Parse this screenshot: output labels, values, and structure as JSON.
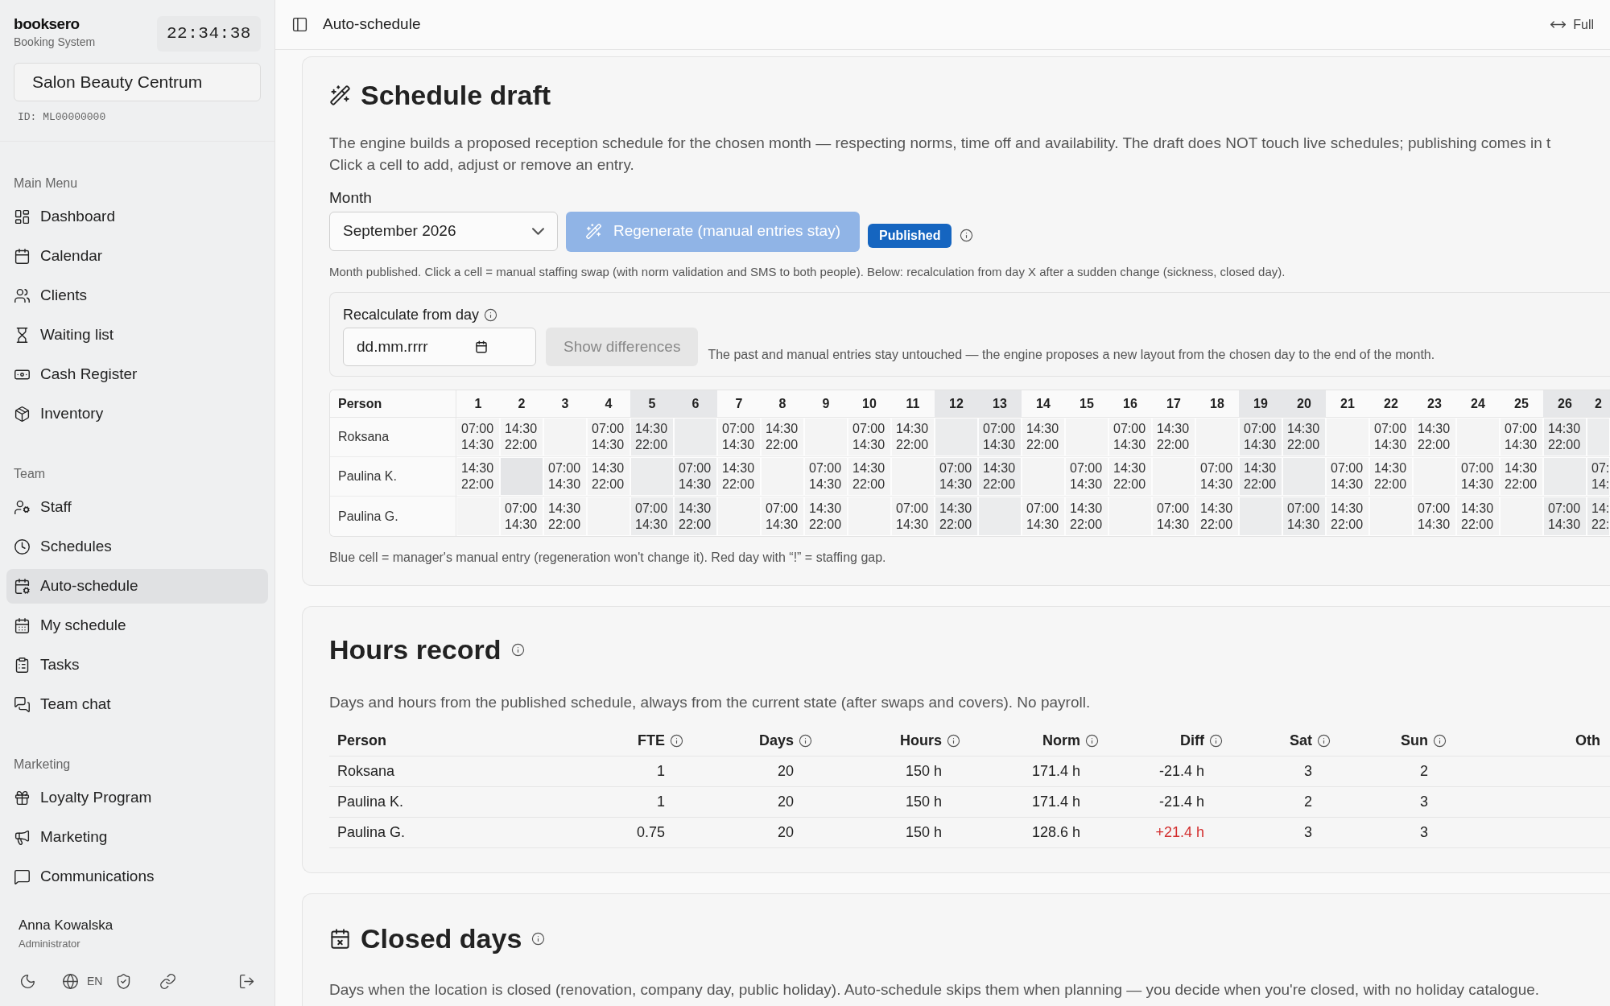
{
  "sidebar": {
    "brand": "booksero",
    "subtitle": "Booking System",
    "clock": "22:34:38",
    "salon": "Salon Beauty Centrum",
    "salon_id": "ID: ML00000000",
    "sections": [
      {
        "title": "Main Menu",
        "items": [
          {
            "label": "Dashboard",
            "selected": false
          },
          {
            "label": "Calendar",
            "selected": false
          },
          {
            "label": "Clients",
            "selected": false
          },
          {
            "label": "Waiting list",
            "selected": false
          },
          {
            "label": "Cash Register",
            "selected": false
          },
          {
            "label": "Inventory",
            "selected": false
          }
        ]
      },
      {
        "title": "Team",
        "items": [
          {
            "label": "Staff",
            "selected": false
          },
          {
            "label": "Schedules",
            "selected": false
          },
          {
            "label": "Auto-schedule",
            "selected": true
          },
          {
            "label": "My schedule",
            "selected": false
          },
          {
            "label": "Tasks",
            "selected": false
          },
          {
            "label": "Team chat",
            "selected": false
          }
        ]
      },
      {
        "title": "Marketing",
        "items": [
          {
            "label": "Loyalty Program",
            "selected": false
          },
          {
            "label": "Marketing",
            "selected": false
          },
          {
            "label": "Communications",
            "selected": false
          }
        ]
      }
    ],
    "user": {
      "name": "Anna Kowalska",
      "role": "Administrator"
    },
    "language": "EN"
  },
  "topbar": {
    "title": "Auto-schedule",
    "full_label": "Full"
  },
  "schedule_draft": {
    "title": "Schedule draft",
    "description": "The engine builds a proposed reception schedule for the chosen month — respecting norms, time off and availability. The draft does NOT touch live schedules; publishing comes in t",
    "description_2": "Click a cell to add, adjust or remove an entry.",
    "month_label": "Month",
    "month_value": "September 2026",
    "regenerate": {
      "label": "Regenerate (manual entries stay)",
      "disabled": true
    },
    "status_badge": "Published",
    "note": "Month published. Click a cell = manual staffing swap (with norm validation and SMS to both people). Below: recalculation from day X after a sudden change (sickness, closed day).",
    "recalc": {
      "label": "Recalculate from day",
      "placeholder": "dd.mm.rrrr",
      "button": {
        "label": "Show differences",
        "disabled": true
      },
      "hint": "The past and manual entries stay untouched — the engine proposes a new layout from the chosen day to the end of the month."
    },
    "table": {
      "person_header": "Person",
      "days": [
        {
          "label": "1",
          "weekend": false
        },
        {
          "label": "2",
          "weekend": false
        },
        {
          "label": "3",
          "weekend": false
        },
        {
          "label": "4",
          "weekend": false
        },
        {
          "label": "5",
          "weekend": true
        },
        {
          "label": "6",
          "weekend": true
        },
        {
          "label": "7",
          "weekend": false
        },
        {
          "label": "8",
          "weekend": false
        },
        {
          "label": "9",
          "weekend": false
        },
        {
          "label": "10",
          "weekend": false
        },
        {
          "label": "11",
          "weekend": false
        },
        {
          "label": "12",
          "weekend": true
        },
        {
          "label": "13",
          "weekend": true
        },
        {
          "label": "14",
          "weekend": false
        },
        {
          "label": "15",
          "weekend": false
        },
        {
          "label": "16",
          "weekend": false
        },
        {
          "label": "17",
          "weekend": false
        },
        {
          "label": "18",
          "weekend": false
        },
        {
          "label": "19",
          "weekend": true
        },
        {
          "label": "20",
          "weekend": true
        },
        {
          "label": "21",
          "weekend": false
        },
        {
          "label": "22",
          "weekend": false
        },
        {
          "label": "23",
          "weekend": false
        },
        {
          "label": "24",
          "weekend": false
        },
        {
          "label": "25",
          "weekend": false
        },
        {
          "label": "26",
          "weekend": true
        },
        {
          "label": "2",
          "weekend": true
        }
      ],
      "rows": [
        {
          "name": "Roksana",
          "cells": [
            {
              "kind": "shift",
              "lines": [
                "07:00",
                "14:30"
              ]
            },
            {
              "kind": "shift",
              "lines": [
                "14:30",
                "22:00"
              ]
            },
            {
              "kind": "empty"
            },
            {
              "kind": "shift",
              "lines": [
                "07:00",
                "14:30"
              ]
            },
            {
              "kind": "shift",
              "lines": [
                "14:30",
                "22:00"
              ]
            },
            {
              "kind": "empty"
            },
            {
              "kind": "shift",
              "lines": [
                "07:00",
                "14:30"
              ]
            },
            {
              "kind": "shift",
              "lines": [
                "14:30",
                "22:00"
              ]
            },
            {
              "kind": "empty"
            },
            {
              "kind": "shift",
              "lines": [
                "07:00",
                "14:30"
              ]
            },
            {
              "kind": "shift",
              "lines": [
                "14:30",
                "22:00"
              ]
            },
            {
              "kind": "empty"
            },
            {
              "kind": "shift",
              "lines": [
                "07:00",
                "14:30"
              ]
            },
            {
              "kind": "shift",
              "lines": [
                "14:30",
                "22:00"
              ]
            },
            {
              "kind": "empty"
            },
            {
              "kind": "shift",
              "lines": [
                "07:00",
                "14:30"
              ]
            },
            {
              "kind": "shift",
              "lines": [
                "14:30",
                "22:00"
              ]
            },
            {
              "kind": "empty"
            },
            {
              "kind": "shift",
              "lines": [
                "07:00",
                "14:30"
              ]
            },
            {
              "kind": "shift",
              "lines": [
                "14:30",
                "22:00"
              ]
            },
            {
              "kind": "empty"
            },
            {
              "kind": "shift",
              "lines": [
                "07:00",
                "14:30"
              ]
            },
            {
              "kind": "shift",
              "lines": [
                "14:30",
                "22:00"
              ]
            },
            {
              "kind": "empty"
            },
            {
              "kind": "shift",
              "lines": [
                "07:00",
                "14:30"
              ]
            },
            {
              "kind": "shift",
              "lines": [
                "14:30",
                "22:00"
              ]
            },
            {
              "kind": "empty"
            }
          ]
        },
        {
          "name": "Paulina K.",
          "cells": [
            {
              "kind": "shift",
              "lines": [
                "14:30",
                "22:00"
              ]
            },
            {
              "kind": "off"
            },
            {
              "kind": "shift",
              "lines": [
                "07:00",
                "14:30"
              ]
            },
            {
              "kind": "shift",
              "lines": [
                "14:30",
                "22:00"
              ]
            },
            {
              "kind": "empty"
            },
            {
              "kind": "shift",
              "lines": [
                "07:00",
                "14:30"
              ]
            },
            {
              "kind": "shift",
              "lines": [
                "14:30",
                "22:00"
              ]
            },
            {
              "kind": "empty"
            },
            {
              "kind": "shift",
              "lines": [
                "07:00",
                "14:30"
              ]
            },
            {
              "kind": "shift",
              "lines": [
                "14:30",
                "22:00"
              ]
            },
            {
              "kind": "empty"
            },
            {
              "kind": "shift",
              "lines": [
                "07:00",
                "14:30"
              ]
            },
            {
              "kind": "shift",
              "lines": [
                "14:30",
                "22:00"
              ]
            },
            {
              "kind": "empty"
            },
            {
              "kind": "shift",
              "lines": [
                "07:00",
                "14:30"
              ]
            },
            {
              "kind": "shift",
              "lines": [
                "14:30",
                "22:00"
              ]
            },
            {
              "kind": "empty"
            },
            {
              "kind": "shift",
              "lines": [
                "07:00",
                "14:30"
              ]
            },
            {
              "kind": "shift",
              "lines": [
                "14:30",
                "22:00"
              ]
            },
            {
              "kind": "empty"
            },
            {
              "kind": "shift",
              "lines": [
                "07:00",
                "14:30"
              ]
            },
            {
              "kind": "shift",
              "lines": [
                "14:30",
                "22:00"
              ]
            },
            {
              "kind": "empty"
            },
            {
              "kind": "shift",
              "lines": [
                "07:00",
                "14:30"
              ]
            },
            {
              "kind": "shift",
              "lines": [
                "14:30",
                "22:00"
              ]
            },
            {
              "kind": "empty"
            },
            {
              "kind": "shift",
              "lines": [
                "07:",
                "14:"
              ]
            }
          ]
        },
        {
          "name": "Paulina G.",
          "cells": [
            {
              "kind": "empty"
            },
            {
              "kind": "shift",
              "lines": [
                "07:00",
                "14:30"
              ]
            },
            {
              "kind": "shift",
              "lines": [
                "14:30",
                "22:00"
              ]
            },
            {
              "kind": "empty"
            },
            {
              "kind": "shift",
              "lines": [
                "07:00",
                "14:30"
              ]
            },
            {
              "kind": "shift",
              "lines": [
                "14:30",
                "22:00"
              ]
            },
            {
              "kind": "empty"
            },
            {
              "kind": "shift",
              "lines": [
                "07:00",
                "14:30"
              ]
            },
            {
              "kind": "shift",
              "lines": [
                "14:30",
                "22:00"
              ]
            },
            {
              "kind": "empty"
            },
            {
              "kind": "shift",
              "lines": [
                "07:00",
                "14:30"
              ]
            },
            {
              "kind": "shift",
              "lines": [
                "14:30",
                "22:00"
              ]
            },
            {
              "kind": "empty"
            },
            {
              "kind": "shift",
              "lines": [
                "07:00",
                "14:30"
              ]
            },
            {
              "kind": "shift",
              "lines": [
                "14:30",
                "22:00"
              ]
            },
            {
              "kind": "empty"
            },
            {
              "kind": "shift",
              "lines": [
                "07:00",
                "14:30"
              ]
            },
            {
              "kind": "shift",
              "lines": [
                "14:30",
                "22:00"
              ]
            },
            {
              "kind": "empty"
            },
            {
              "kind": "shift",
              "lines": [
                "07:00",
                "14:30"
              ]
            },
            {
              "kind": "shift",
              "lines": [
                "14:30",
                "22:00"
              ]
            },
            {
              "kind": "empty"
            },
            {
              "kind": "shift",
              "lines": [
                "07:00",
                "14:30"
              ]
            },
            {
              "kind": "shift",
              "lines": [
                "14:30",
                "22:00"
              ]
            },
            {
              "kind": "empty"
            },
            {
              "kind": "shift",
              "lines": [
                "07:00",
                "14:30"
              ]
            },
            {
              "kind": "shift",
              "lines": [
                "14:",
                "22:"
              ]
            }
          ]
        }
      ]
    },
    "legend": "Blue cell = manager's manual entry (regeneration won't change it). Red day with “!” = staffing gap."
  },
  "hours_record": {
    "title": "Hours record",
    "description": "Days and hours from the published schedule, always from the current state (after swaps and covers). No payroll.",
    "columns": [
      {
        "label": "Person",
        "info": false
      },
      {
        "label": "FTE",
        "info": true
      },
      {
        "label": "Days",
        "info": true
      },
      {
        "label": "Hours",
        "info": true
      },
      {
        "label": "Norm",
        "info": true
      },
      {
        "label": "Diff",
        "info": true
      },
      {
        "label": "Sat",
        "info": true
      },
      {
        "label": "Sun",
        "info": true
      },
      {
        "label": "Oth",
        "info": false
      }
    ],
    "rows": [
      {
        "person": "Roksana",
        "fte": "1",
        "days": "20",
        "hours": "150 h",
        "norm": "171.4 h",
        "diff": "-21.4 h",
        "diff_alert": false,
        "sat": "3",
        "sun": "2"
      },
      {
        "person": "Paulina K.",
        "fte": "1",
        "days": "20",
        "hours": "150 h",
        "norm": "171.4 h",
        "diff": "-21.4 h",
        "diff_alert": false,
        "sat": "2",
        "sun": "3"
      },
      {
        "person": "Paulina G.",
        "fte": "0.75",
        "days": "20",
        "hours": "150 h",
        "norm": "128.6 h",
        "diff": "+21.4 h",
        "diff_alert": true,
        "sat": "3",
        "sun": "3"
      }
    ]
  },
  "closed_days": {
    "title": "Closed days",
    "description": "Days when the location is closed (renovation, company day, public holiday). Auto-schedule skips them when planning — you decide when you're closed, with no holiday catalogue."
  }
}
